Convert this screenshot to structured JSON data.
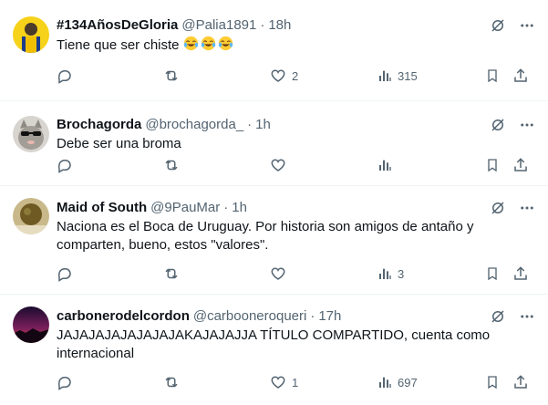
{
  "tweets": [
    {
      "name": "#134AñosDeGloria",
      "handle": "@Palia1891",
      "sep": "·",
      "time": "18h",
      "text": "Tiene que ser chiste",
      "emoji": [
        "face-with-tears-of-joy",
        "face-with-tears-of-joy",
        "face-with-tears-of-joy"
      ],
      "likes": "2",
      "views": "315",
      "avatar_color": "#f2c200"
    },
    {
      "name": "Brochagorda",
      "handle": "@brochagorda_",
      "sep": "·",
      "time": "1h",
      "text": "Debe ser una broma",
      "likes": "",
      "views": "",
      "avatar_color": "#b9b4ae"
    },
    {
      "name": "Maid of South",
      "handle": "@9PauMar",
      "sep": "·",
      "time": "1h",
      "text": "Naciona es el Boca de Uruguay. Por historia son amigos de antaño y comparten, bueno, estos \"valores\".",
      "likes": "",
      "views": "3",
      "avatar_color": "#7a6a2b"
    },
    {
      "name": "carbonerodelcordon",
      "handle": "@carbooneroqueri",
      "sep": "·",
      "time": "17h",
      "text": "JAJAJAJAJAJAJAJAKAJAJAJJA TÍTULO COMPARTIDO, cuenta como internacional",
      "likes": "1",
      "views": "697",
      "avatar_color": "#3a1230"
    }
  ],
  "icons": {
    "grok": "grok-icon",
    "more": "more-icon",
    "reply": "reply-icon",
    "retweet": "retweet-icon",
    "like": "like-icon",
    "views": "views-icon",
    "bookmark": "bookmark-icon",
    "share": "share-icon"
  },
  "colors": {
    "text": "#0f1419",
    "secondary": "#536471",
    "divider": "#eff3f4"
  }
}
